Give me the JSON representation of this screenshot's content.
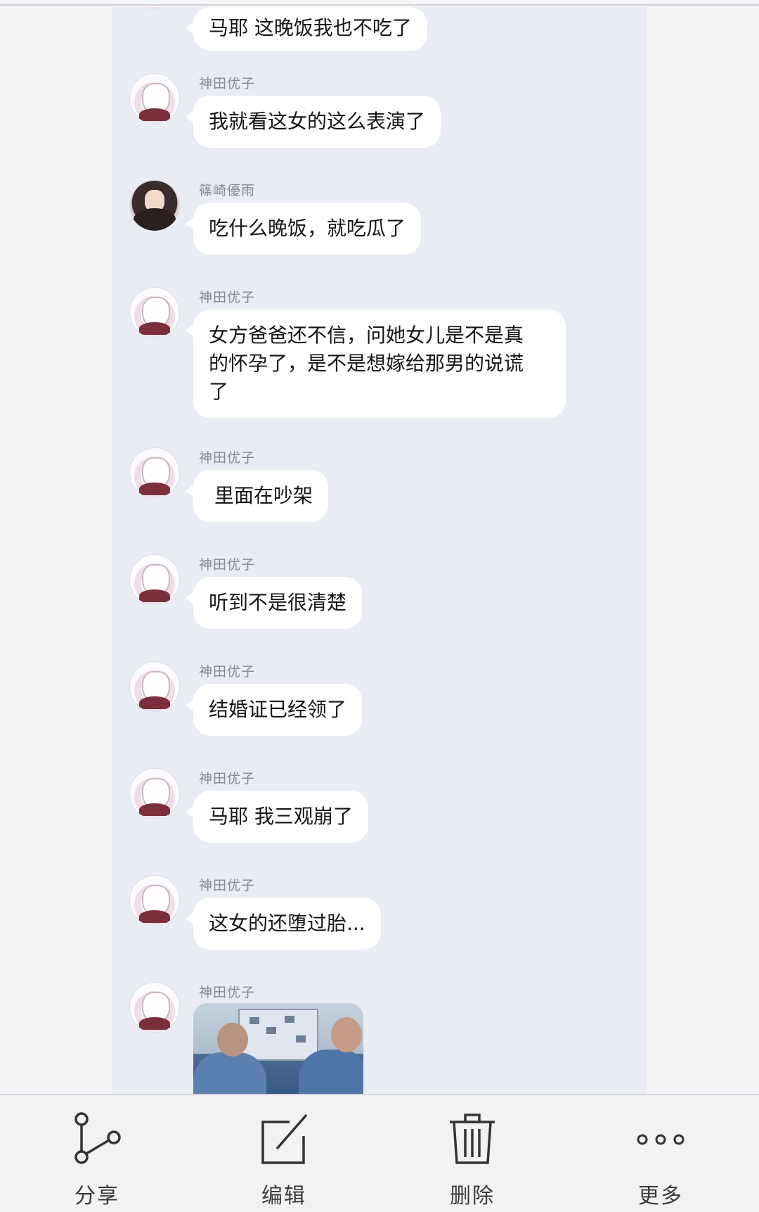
{
  "messages": [
    {
      "sender": "",
      "text": "马耶 这晚饭我也不吃了"
    },
    {
      "sender": "神田优子",
      "text": "我就看这女的这么表演了"
    },
    {
      "sender": "篠崎優雨",
      "text": "吃什么晚饭，就吃瓜了"
    },
    {
      "sender": "神田优子",
      "text_lines": [
        "女方爸爸还不信，问她女儿是不是真",
        "的怀孕了，是不是想嫁给那男的说谎",
        "了"
      ]
    },
    {
      "sender": "神田优子",
      "text": "里面在吵架"
    },
    {
      "sender": "神田优子",
      "text": "听到不是很清楚"
    },
    {
      "sender": "神田优子",
      "text": "结婚证已经领了"
    },
    {
      "sender": "神田优子",
      "text": "马耶 我三观崩了"
    },
    {
      "sender": "神田优子",
      "text": "这女的还堕过胎..."
    },
    {
      "sender": "神田优子",
      "image": "police-office-photo"
    }
  ],
  "toolbar": {
    "share": {
      "label": "分享",
      "icon": "share-icon"
    },
    "edit": {
      "label": "编辑",
      "icon": "edit-icon"
    },
    "delete": {
      "label": "删除",
      "icon": "trash-icon"
    },
    "more": {
      "label": "更多",
      "icon": "more-icon"
    }
  }
}
